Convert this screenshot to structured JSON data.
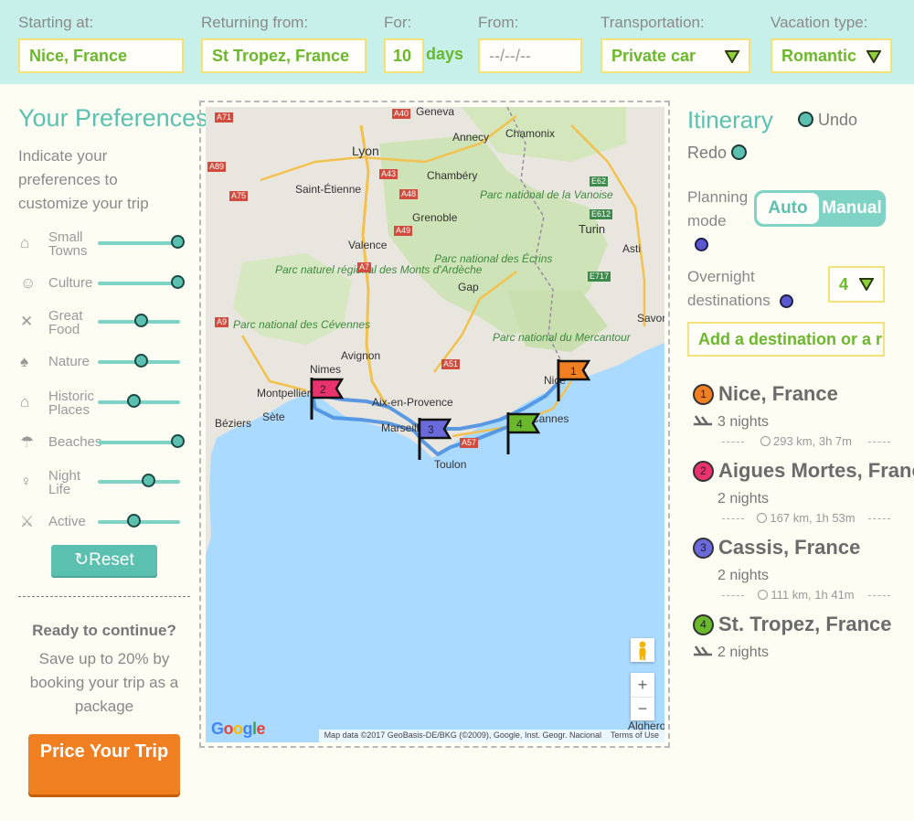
{
  "topbar": {
    "starting_label": "Starting at:",
    "starting_value": "Nice, France",
    "returning_label": "Returning from:",
    "returning_value": "St Tropez, France",
    "for_label": "For:",
    "for_value": "10",
    "days_suffix": "days",
    "from_label": "From:",
    "from_value": "--/--/--",
    "transport_label": "Transportation:",
    "transport_value": "Private car",
    "vacation_label": "Vacation type:",
    "vacation_value": "Romantic"
  },
  "preferences": {
    "title": "Your Preferences",
    "description": "Indicate your preferences to customize your trip",
    "items": [
      {
        "label_line1": "Small",
        "label_line2": "Towns",
        "icon": "houses-icon",
        "level": 1.0
      },
      {
        "label_line1": "Culture",
        "label_line2": "",
        "icon": "theater-masks-icon",
        "level": 1.0
      },
      {
        "label_line1": "Great",
        "label_line2": "Food",
        "icon": "fork-knife-icon",
        "level": 0.5
      },
      {
        "label_line1": "Nature",
        "label_line2": "",
        "icon": "tree-icon",
        "level": 0.5
      },
      {
        "label_line1": "Historic",
        "label_line2": "Places",
        "icon": "monument-icon",
        "level": 0.4
      },
      {
        "label_line1": "Beaches",
        "label_line2": "",
        "icon": "beach-umbrella-icon",
        "level": 1.0
      },
      {
        "label_line1": "Night",
        "label_line2": "Life",
        "icon": "wine-glass-icon",
        "level": 0.6
      },
      {
        "label_line1": "Active",
        "label_line2": "",
        "icon": "hikers-icon",
        "level": 0.4
      }
    ],
    "reset_label": "Reset",
    "ready_text": "Ready to continue?",
    "save_text": "Save up to 20% by booking your trip as a package",
    "price_button": "Price Your Trip"
  },
  "map": {
    "attribution": "Map data ©2017 GeoBasis-DE/BKG (©2009), Google, Inst. Geogr. Nacional",
    "terms": "Terms of Use",
    "zoom_in": "+",
    "zoom_out": "−",
    "cities": [
      "Geneva",
      "Annecy",
      "Chamonix",
      "Lyon",
      "Chambéry",
      "Saint-Étienne",
      "Grenoble",
      "Turin",
      "Asti",
      "Valence",
      "Gap",
      "Savona",
      "Nimes",
      "Avignon",
      "Montpellier",
      "Béziers",
      "Sète",
      "Aix-en-Provence",
      "Marseille",
      "Toulon",
      "Nice",
      "Cannes",
      "Alghero"
    ],
    "parks": [
      "Parc national de la Vanoise",
      "Parc national des Écrins",
      "Parc naturel régional des Monts d'Ardèche",
      "Parc national des Cévennes",
      "Parc national du Mercantour"
    ],
    "roads": [
      "A71",
      "A40",
      "A89",
      "A43",
      "A48",
      "A75",
      "A49",
      "A7",
      "E612",
      "E717",
      "E62",
      "A51",
      "A57",
      "A9"
    ],
    "flags": [
      {
        "num": "1",
        "color": "#f07f22"
      },
      {
        "num": "2",
        "color": "#e8336e"
      },
      {
        "num": "3",
        "color": "#6a6adb"
      },
      {
        "num": "4",
        "color": "#6ab82b"
      }
    ]
  },
  "itinerary": {
    "title": "Itinerary",
    "undo": "Undo",
    "redo": "Redo",
    "planning_label": "Planning mode",
    "mode_auto": "Auto",
    "mode_manual": "Manual",
    "overnight_label": "Overnight destinations",
    "overnight_value": "4",
    "add_destination": "Add a destination or a r",
    "stops": [
      {
        "num": "1",
        "name": "Nice, France",
        "nights": "3 nights",
        "color": "#f07f22"
      },
      {
        "num": "2",
        "name": "Aigues Mortes, France",
        "nights": "2 nights",
        "color": "#e8336e"
      },
      {
        "num": "3",
        "name": "Cassis, France",
        "nights": "2 nights",
        "color": "#6a6adb"
      },
      {
        "num": "4",
        "name": "St. Tropez, France",
        "nights": "2 nights",
        "color": "#6ab82b"
      }
    ],
    "legs": [
      "293 km, 3h 7m",
      "167 km, 1h 53m",
      "111 km, 1h 41m"
    ]
  },
  "colors": {
    "accent": "#5cc0b0",
    "value_green": "#6ab82b",
    "topbar_bg": "#c8f0ea",
    "price_orange": "#f07f22"
  }
}
